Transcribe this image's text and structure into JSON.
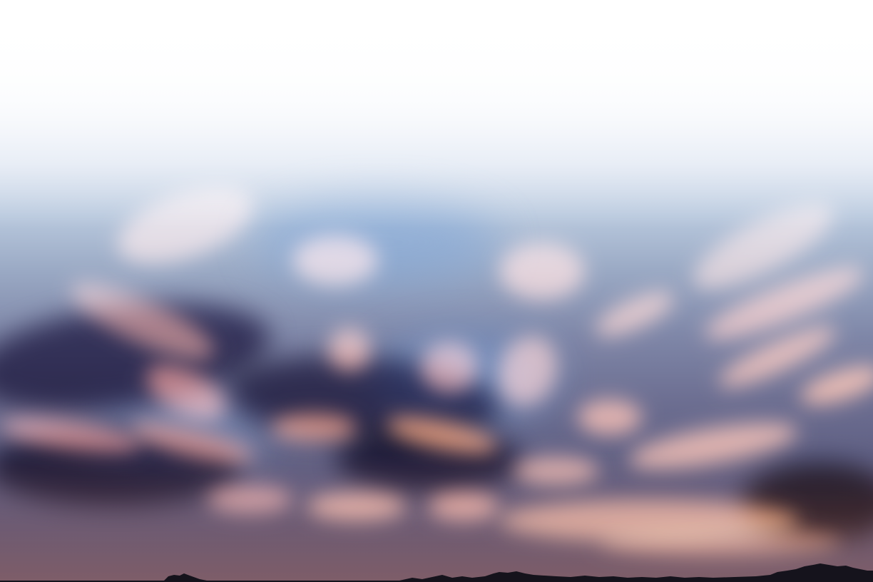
{
  "image": {
    "subject": "sunset-sky",
    "colors": {
      "sky_top": "#ffffff",
      "sky_blue": "#7fa7d6",
      "cloud_orange": "#f59a6a",
      "cloud_pink": "#f2a08e",
      "cloud_shadow": "#5a5478",
      "horizon_dark": "#3f3a58",
      "tree_silhouette": "#15131c"
    }
  }
}
